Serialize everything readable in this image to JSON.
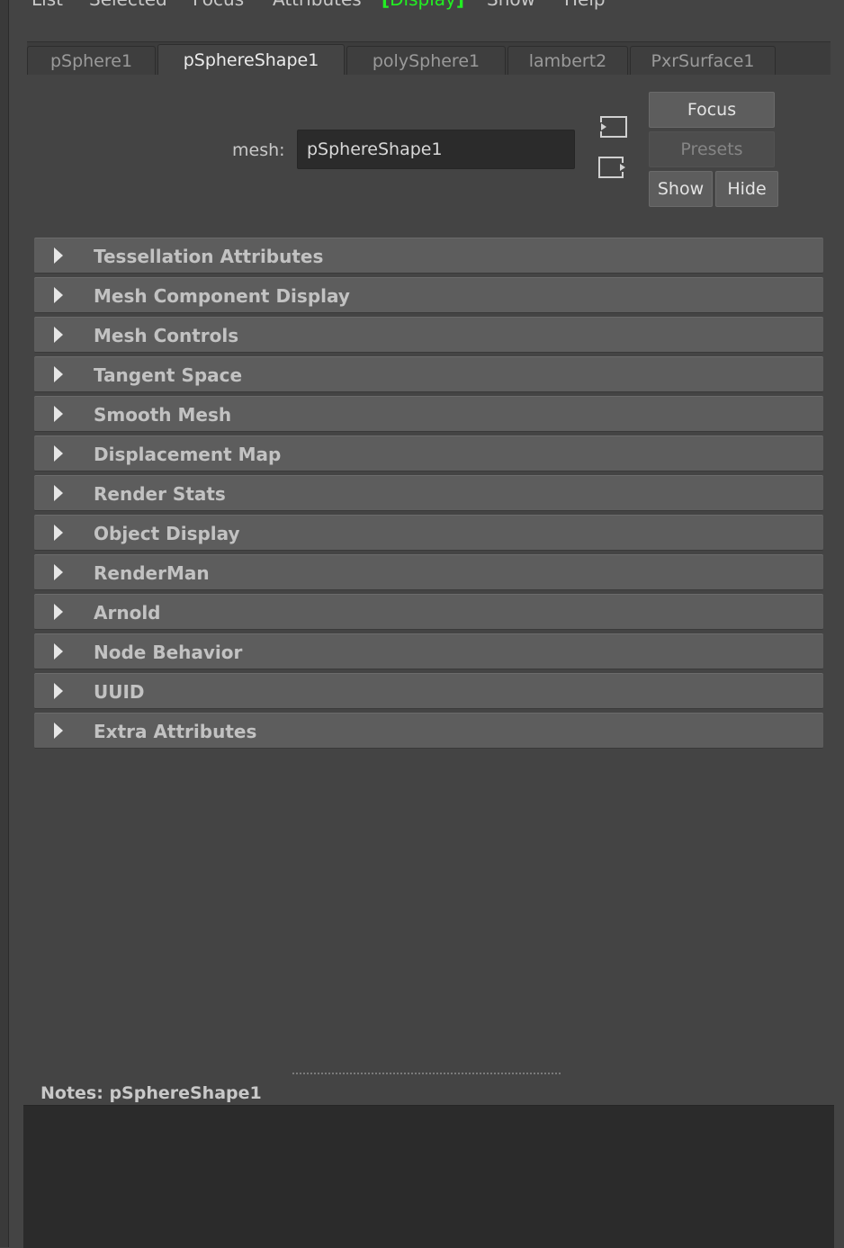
{
  "menubar": {
    "items": [
      {
        "label": "List"
      },
      {
        "label": "Selected"
      },
      {
        "label": "Focus"
      },
      {
        "label": "Attributes"
      },
      {
        "label": "Display",
        "active": true
      },
      {
        "label": "Show"
      },
      {
        "label": "Help"
      }
    ]
  },
  "tabs": [
    {
      "label": "pSphere1"
    },
    {
      "label": "pSphereShape1",
      "active": true
    },
    {
      "label": "polySphere1"
    },
    {
      "label": "lambert2"
    },
    {
      "label": "PxrSurface1"
    }
  ],
  "header": {
    "mesh_label": "mesh:",
    "mesh_value": "pSphereShape1",
    "focus_label": "Focus",
    "presets_label": "Presets",
    "show_label": "Show",
    "hide_label": "Hide",
    "icons": [
      "go-to-input-icon",
      "go-to-output-icon"
    ]
  },
  "sections": [
    {
      "label": "Tessellation Attributes"
    },
    {
      "label": "Mesh Component Display"
    },
    {
      "label": "Mesh Controls"
    },
    {
      "label": "Tangent Space"
    },
    {
      "label": "Smooth Mesh"
    },
    {
      "label": "Displacement Map"
    },
    {
      "label": "Render Stats"
    },
    {
      "label": "Object Display"
    },
    {
      "label": "RenderMan"
    },
    {
      "label": "Arnold"
    },
    {
      "label": "Node Behavior"
    },
    {
      "label": "UUID"
    },
    {
      "label": "Extra Attributes"
    }
  ],
  "notes": {
    "label": "Notes:  pSphereShape1",
    "text": ""
  },
  "colors": {
    "background": "#444444",
    "frame": "#5d5d5d",
    "field": "#2b2b2b",
    "active_menu": "#22ee22"
  }
}
